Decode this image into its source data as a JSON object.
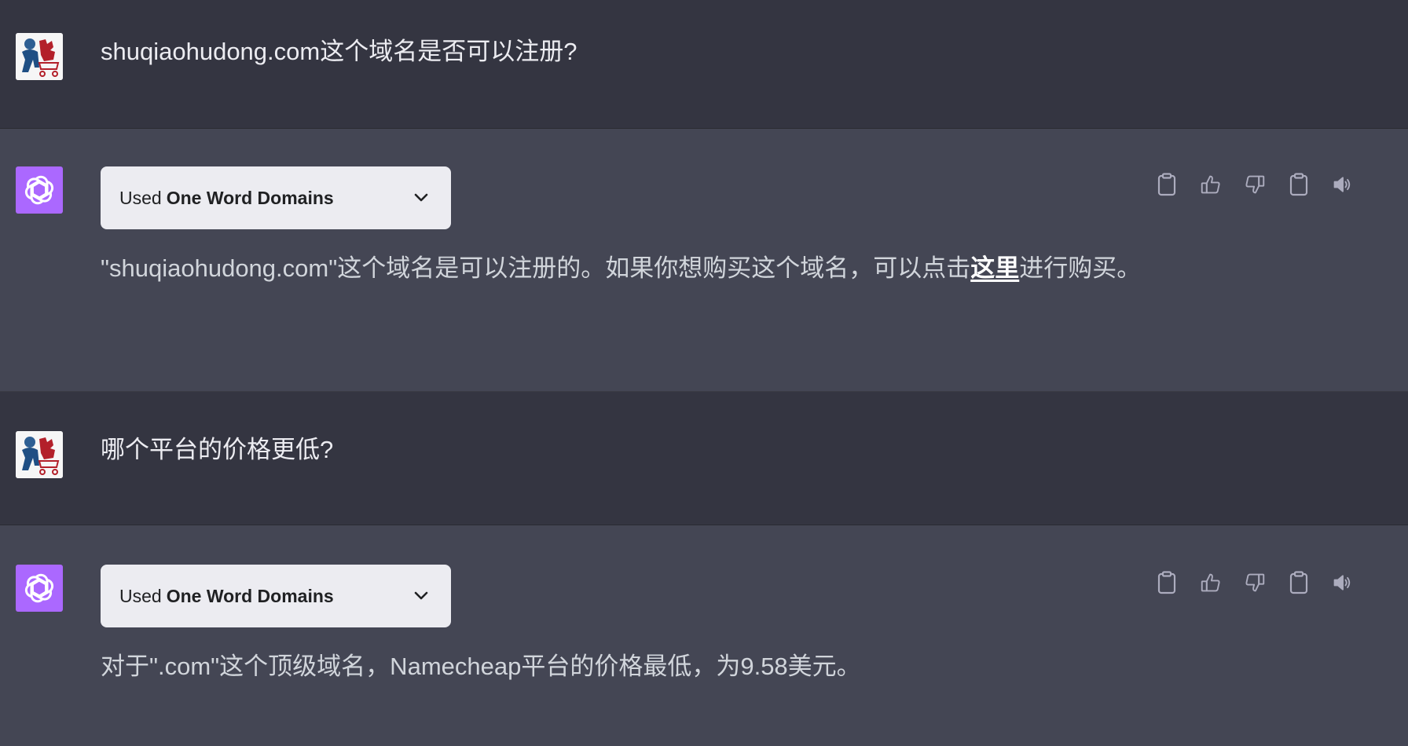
{
  "conversation": [
    {
      "role": "user",
      "text": "shuqiaohudong.com这个域名是否可以注册?"
    },
    {
      "role": "assistant",
      "plugin": {
        "used_label": "Used",
        "name": "One Word Domains"
      },
      "text_before": "\"shuqiaohudong.com\"这个域名是可以注册的。如果你想购买这个域名，可以点击",
      "link_text": "这里",
      "text_after": "进行购买。"
    },
    {
      "role": "user",
      "text": "哪个平台的价格更低?"
    },
    {
      "role": "assistant",
      "plugin": {
        "used_label": "Used",
        "name": "One Word Domains"
      },
      "text": "对于\".com\"这个顶级域名，Namecheap平台的价格最低，为9.58美元。"
    }
  ],
  "action_icons": [
    "clipboard-icon",
    "thumbs-up-icon",
    "thumbs-down-icon",
    "clipboard-icon",
    "speaker-icon"
  ],
  "colors": {
    "user_bg": "#343541",
    "assistant_bg": "#444654",
    "assistant_avatar": "#ab68ff",
    "plugin_pill_bg": "#ececf1"
  }
}
